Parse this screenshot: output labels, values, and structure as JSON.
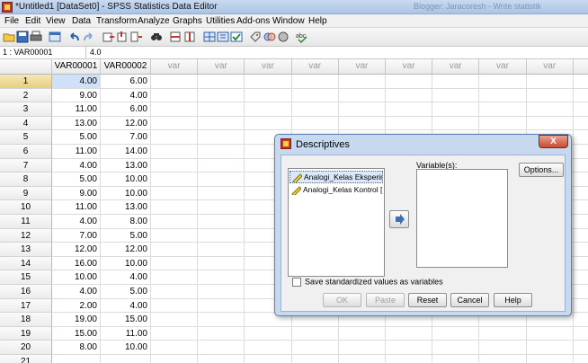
{
  "window": {
    "title": "*Untitled1 [DataSet0] - SPSS Statistics Data Editor",
    "ghost_title": "Blogger: Jaracoresh  - Write  statistik"
  },
  "menu": [
    "File",
    "Edit",
    "View",
    "Data",
    "Transform",
    "Analyze",
    "Graphs",
    "Utilities",
    "Add-ons",
    "Window",
    "Help"
  ],
  "toolbar": {
    "icons": [
      "open-folder-icon",
      "save-icon",
      "print-icon",
      "dialog-recall-icon",
      "undo-icon",
      "redo-icon",
      "goto-case-icon",
      "goto-variable-icon",
      "variables-icon",
      "find-icon",
      "insert-cases-icon",
      "insert-variable-icon",
      "split-file-icon",
      "weight-cases-icon",
      "select-cases-icon",
      "value-labels-icon",
      "use-sets-icon",
      "show-all-icon",
      "spelling-icon"
    ]
  },
  "cell_editor": {
    "reference": "1 : VAR00001",
    "value": "4.0"
  },
  "grid": {
    "columns": [
      "VAR00001",
      "VAR00002",
      "var",
      "var",
      "var",
      "var",
      "var",
      "var",
      "var",
      "var",
      "var",
      "var"
    ],
    "rows": [
      {
        "n": "1",
        "v1": "4.00",
        "v2": "6.00"
      },
      {
        "n": "2",
        "v1": "9.00",
        "v2": "4.00"
      },
      {
        "n": "3",
        "v1": "11.00",
        "v2": "6.00"
      },
      {
        "n": "4",
        "v1": "13.00",
        "v2": "12.00"
      },
      {
        "n": "5",
        "v1": "5.00",
        "v2": "7.00"
      },
      {
        "n": "6",
        "v1": "11.00",
        "v2": "14.00"
      },
      {
        "n": "7",
        "v1": "4.00",
        "v2": "13.00"
      },
      {
        "n": "8",
        "v1": "5.00",
        "v2": "10.00"
      },
      {
        "n": "9",
        "v1": "9.00",
        "v2": "10.00"
      },
      {
        "n": "10",
        "v1": "11.00",
        "v2": "13.00"
      },
      {
        "n": "11",
        "v1": "4.00",
        "v2": "8.00"
      },
      {
        "n": "12",
        "v1": "7.00",
        "v2": "5.00"
      },
      {
        "n": "13",
        "v1": "12.00",
        "v2": "12.00"
      },
      {
        "n": "14",
        "v1": "16.00",
        "v2": "10.00"
      },
      {
        "n": "15",
        "v1": "10.00",
        "v2": "4.00"
      },
      {
        "n": "16",
        "v1": "4.00",
        "v2": "5.00"
      },
      {
        "n": "17",
        "v1": "2.00",
        "v2": "4.00"
      },
      {
        "n": "18",
        "v1": "19.00",
        "v2": "15.00"
      },
      {
        "n": "19",
        "v1": "15.00",
        "v2": "11.00"
      },
      {
        "n": "20",
        "v1": "8.00",
        "v2": "10.00"
      },
      {
        "n": "21",
        "v1": "",
        "v2": ""
      }
    ]
  },
  "dialog": {
    "title": "Descriptives",
    "close_label": "X",
    "source_items": [
      "Analogi_Kelas Eksperim...",
      "Analogi_Kelas Kontrol [..."
    ],
    "variables_label": "Variable(s):",
    "options_label": "Options...",
    "checkbox_label": "Save standardized values as variables",
    "buttons": {
      "ok": "OK",
      "paste": "Paste",
      "reset": "Reset",
      "cancel": "Cancel",
      "help": "Help"
    }
  }
}
